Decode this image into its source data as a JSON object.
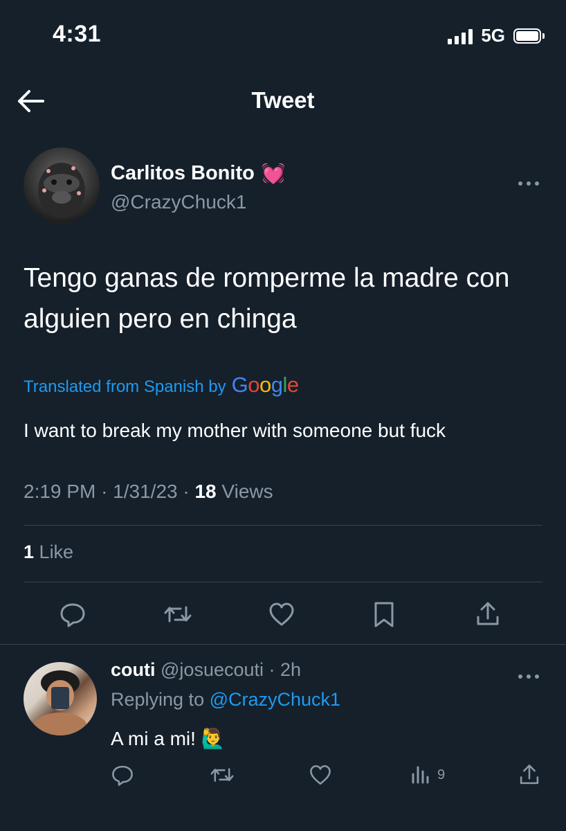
{
  "status_bar": {
    "time": "4:31",
    "network": "5G"
  },
  "header": {
    "title": "Tweet"
  },
  "tweet": {
    "display_name": "Carlitos Bonito",
    "name_emoji": "💓",
    "handle": "@CrazyChuck1",
    "text": "Tengo ganas de romperme la madre con alguien pero en chinga",
    "translated_label": "Translated from Spanish by",
    "translator": "Google",
    "translation": "I want to break my mother with someone but fuck",
    "time": "2:19 PM",
    "date": "1/31/23",
    "views_count": "18",
    "views_label": "Views",
    "likes_count": "1",
    "likes_label": "Like"
  },
  "reply": {
    "display_name": "couti",
    "handle": "@josuecouti",
    "age": "2h",
    "replying_label": "Replying to",
    "replying_handle": "@CrazyChuck1",
    "text": "A mi a mi!",
    "emoji": "🙋‍♂️",
    "views_count": "9"
  },
  "icons": {
    "back": "arrow-left-icon",
    "more": "more-dots-icon",
    "reply": "comment-icon",
    "retweet": "retweet-icon",
    "like": "heart-icon",
    "bookmark": "bookmark-icon",
    "share": "share-icon",
    "views": "views-bars-icon"
  },
  "colors": {
    "background": "#15202b",
    "link": "#1d9bf0",
    "secondary_text": "#8b98a5",
    "divider": "#38444d"
  }
}
